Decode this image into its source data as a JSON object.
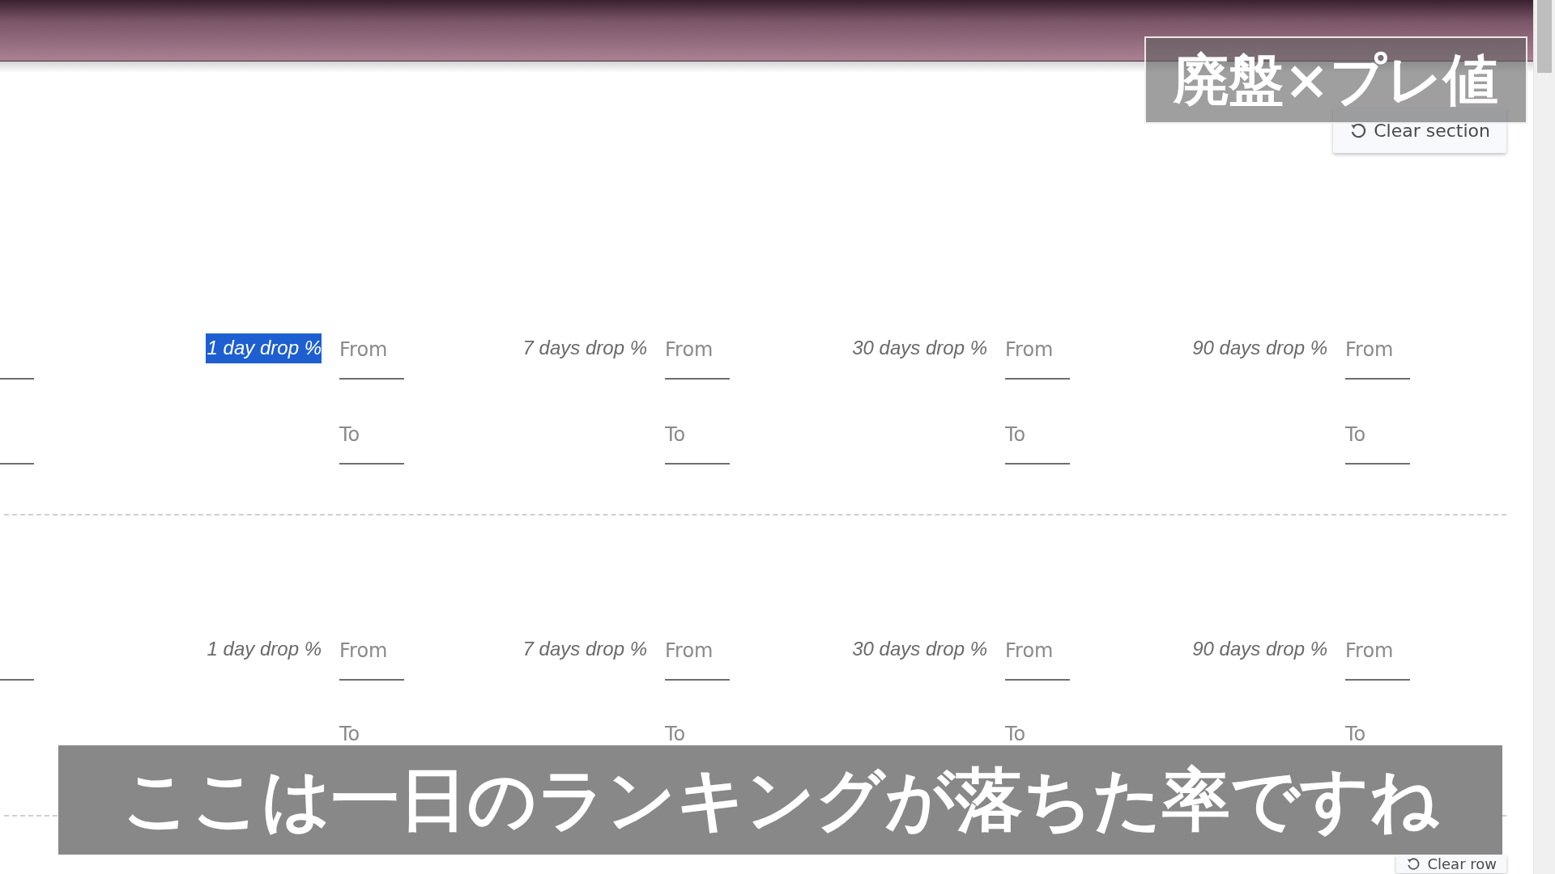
{
  "overlay_title": "廃盤×プレ値",
  "clear_section_button": "Clear section",
  "sections": [
    {
      "filters": [
        {
          "label": "1 day drop %",
          "highlighted": true,
          "from_placeholder": "From",
          "to_placeholder": "To"
        },
        {
          "label": "7 days drop %",
          "highlighted": false,
          "from_placeholder": "From",
          "to_placeholder": "To"
        },
        {
          "label": "30 days drop %",
          "highlighted": false,
          "from_placeholder": "From",
          "to_placeholder": "To"
        },
        {
          "label": "90 days drop %",
          "highlighted": false,
          "from_placeholder": "From",
          "to_placeholder": "To"
        }
      ]
    },
    {
      "filters": [
        {
          "label": "1 day drop %",
          "highlighted": false,
          "from_placeholder": "From",
          "to_placeholder": "To"
        },
        {
          "label": "7 days drop %",
          "highlighted": false,
          "from_placeholder": "From",
          "to_placeholder": "To"
        },
        {
          "label": "30 days drop %",
          "highlighted": false,
          "from_placeholder": "From",
          "to_placeholder": "To"
        },
        {
          "label": "90 days drop %",
          "highlighted": false,
          "from_placeholder": "From",
          "to_placeholder": "To"
        }
      ],
      "clear_row_button": "Clear row"
    }
  ],
  "caption": "ここは一日のランキングが落ちた率ですね"
}
